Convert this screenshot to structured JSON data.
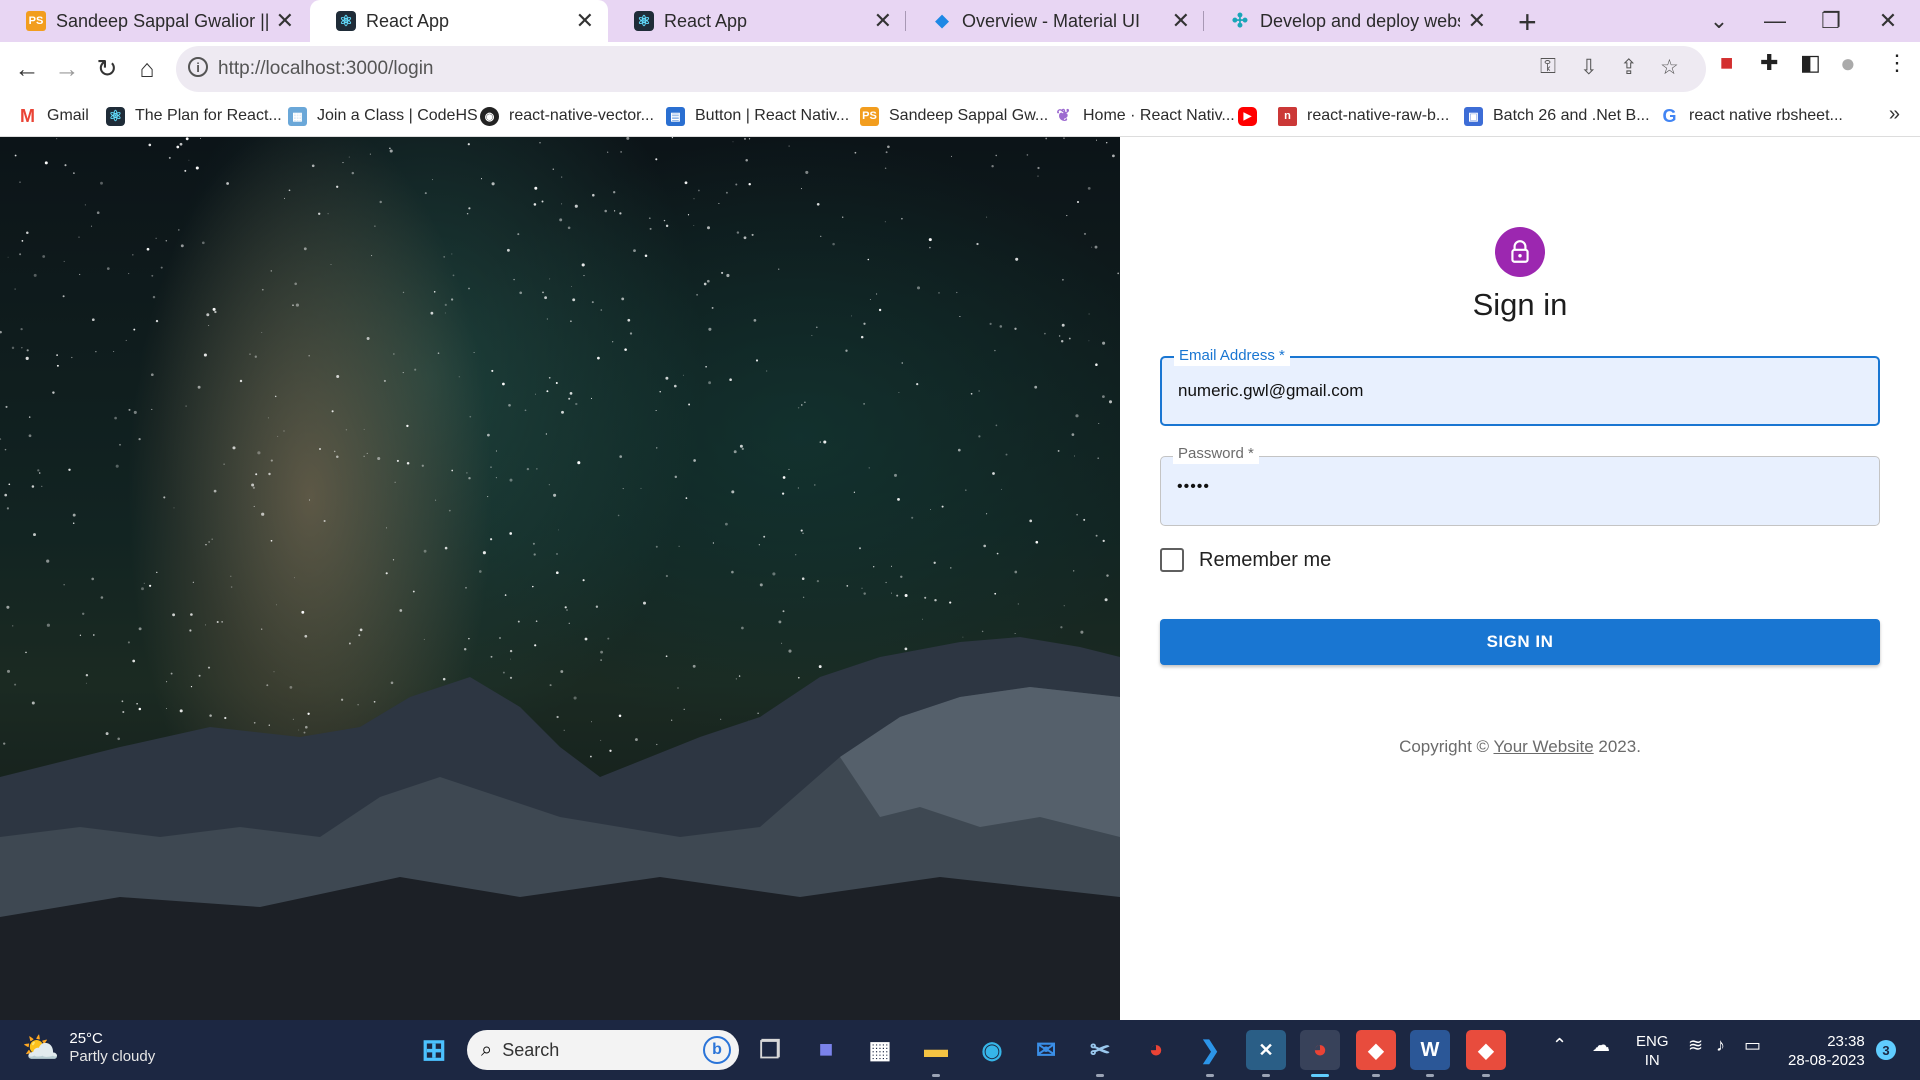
{
  "browser": {
    "tabs": [
      {
        "title": "Sandeep Sappal Gwalior || Best S",
        "favicon": "ps-favicon",
        "active": false
      },
      {
        "title": "React App",
        "favicon": "react-favicon",
        "active": true
      },
      {
        "title": "React App",
        "favicon": "react-favicon",
        "active": false
      },
      {
        "title": "Overview - Material UI",
        "favicon": "mui-favicon",
        "active": false
      },
      {
        "title": "Develop and deploy websites and",
        "favicon": "netlify-favicon",
        "active": false
      }
    ],
    "url": "http://localhost:3000/login",
    "bookmarks": [
      {
        "label": "Gmail",
        "icon": "gmail-icon"
      },
      {
        "label": "The Plan for React...",
        "icon": "react-favicon"
      },
      {
        "label": "Join a Class | CodeHS",
        "icon": "codehs-icon"
      },
      {
        "label": "react-native-vector...",
        "icon": "github-icon"
      },
      {
        "label": "Button | React Nativ...",
        "icon": "rn-docs-icon"
      },
      {
        "label": "Sandeep Sappal Gw...",
        "icon": "ps-favicon"
      },
      {
        "label": "Home · React Nativ...",
        "icon": "rn-paper-icon"
      },
      {
        "label": "",
        "icon": "youtube-icon"
      },
      {
        "label": "react-native-raw-b...",
        "icon": "npm-icon"
      },
      {
        "label": "Batch 26 and .Net B...",
        "icon": "classroom-icon"
      },
      {
        "label": "react native rbsheet...",
        "icon": "google-icon"
      }
    ]
  },
  "login": {
    "title": "Sign in",
    "email_label": "Email Address *",
    "email_value": "numeric.gwl@gmail.com",
    "password_label": "Password *",
    "password_value": "•••••",
    "remember_label": "Remember me",
    "remember_checked": false,
    "submit_label": "SIGN IN",
    "copyright_prefix": "Copyright © ",
    "copyright_link": "Your Website",
    "copyright_suffix": " 2023.",
    "accent_color": "#1976d2",
    "avatar_color": "#9c27b0"
  },
  "taskbar": {
    "temperature": "25°C",
    "weather": "Partly cloudy",
    "search_placeholder": "Search",
    "lang_line1": "ENG",
    "lang_line2": "IN",
    "time": "23:38",
    "date": "28-08-2023",
    "notification_count": "3"
  }
}
